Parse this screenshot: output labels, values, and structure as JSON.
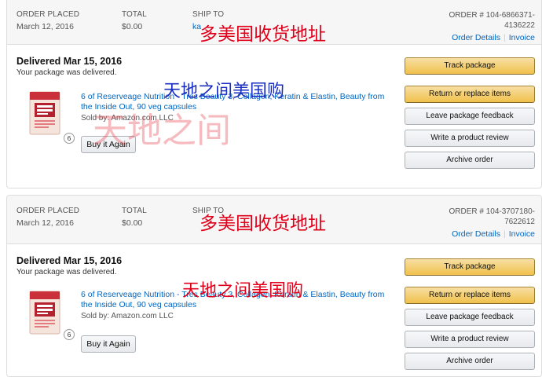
{
  "orders": [
    {
      "header": {
        "placed_label": "ORDER PLACED",
        "placed_value": "March 12, 2016",
        "total_label": "TOTAL",
        "total_value": "$0.00",
        "ship_label": "SHIP TO",
        "ship_value": "ka",
        "order_number_line1": "ORDER # 104-6866371-",
        "order_number_line2": "4136222",
        "order_details_link": "Order Details",
        "invoice_link": "Invoice"
      },
      "status_title": "Delivered Mar 15, 2016",
      "status_sub": "Your package was delivered.",
      "quantity": "6",
      "product_title": "6 of Reserveage Nutrition - Tres Beauty 3, Collagen, Keratin & Elastin, Beauty from the Inside Out, 90 veg capsules",
      "sold_by": "Sold by: Amazon.com LLC",
      "buy_again": "Buy it Again",
      "actions": {
        "track": "Track package",
        "return": "Return or replace items",
        "feedback": "Leave package feedback",
        "review": "Write a product review",
        "archive": "Archive order"
      }
    },
    {
      "header": {
        "placed_label": "ORDER PLACED",
        "placed_value": "March 12, 2016",
        "total_label": "TOTAL",
        "total_value": "$0.00",
        "ship_label": "SHIP TO",
        "ship_value": "",
        "order_number_line1": "ORDER # 104-3707180-",
        "order_number_line2": "7622612",
        "order_details_link": "Order Details",
        "invoice_link": "Invoice"
      },
      "status_title": "Delivered Mar 15, 2016",
      "status_sub": "Your package was delivered.",
      "quantity": "6",
      "product_title": "6 of Reserveage Nutrition - Tres Beauty 3, Collagen, Keratin & Elastin, Beauty from the Inside Out, 90 veg capsules",
      "sold_by": "Sold by: Amazon.com LLC",
      "buy_again": "Buy it Again",
      "actions": {
        "track": "Track package",
        "return": "Return or replace items",
        "feedback": "Leave package feedback",
        "review": "Write a product review",
        "archive": "Archive order"
      }
    }
  ],
  "watermarks": {
    "address": "多美国收货地址",
    "shop": "天地之间美国购",
    "big": "天地之间"
  },
  "colors": {
    "link": "#0066c0",
    "button_yellow": "#f0c14b",
    "watermark_red": "#e0001a",
    "watermark_blue": "#1a2ec0"
  },
  "product_image_icon": "supplement-bottle-box-icon"
}
